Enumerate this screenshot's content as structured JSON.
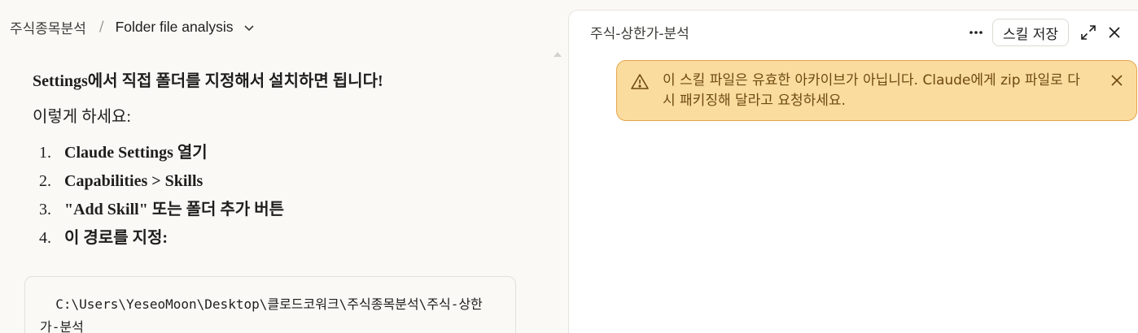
{
  "breadcrumb": {
    "project": "주식종목분석",
    "separator": "/",
    "conversation_title": "Folder file analysis"
  },
  "message": {
    "heading": "Settings에서 직접 폴더를 지정해서 설치하면 됩니다!",
    "intro": "이렇게 하세요:",
    "steps": [
      {
        "num": "1.",
        "text": "Claude Settings 열기"
      },
      {
        "num": "2.",
        "text": "Capabilities > Skills"
      },
      {
        "num": "3.",
        "text": "\"Add Skill\" 또는 폴더 추가 버튼"
      },
      {
        "num": "4.",
        "text": "이 경로를 지정:"
      }
    ],
    "code": "  C:\\Users\\YeseoMoon\\Desktop\\클로드코워크\\주식종목분석\\주식-상한가-분석"
  },
  "panel": {
    "title": "주식-상한가-분석",
    "save_label": "스킬 저장",
    "toast_message": "이 스킬 파일은 유효한 아카이브가 아닙니다. Claude에게 zip 파일로 다시 패키징해 달라고 요청하세요."
  },
  "colors": {
    "toast_bg": "#fbdc9f",
    "toast_border": "#e2a64a",
    "toast_text": "#6e4a11"
  },
  "icons": [
    "chevron-down-icon",
    "more-icon",
    "expand-icon",
    "close-icon",
    "warning-icon",
    "close-toast-icon"
  ]
}
